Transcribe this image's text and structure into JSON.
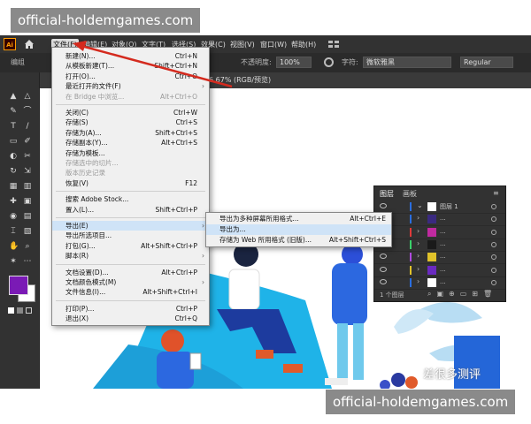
{
  "watermark": {
    "top_text": "official-holdemgames.com",
    "bottom_text": "official-holdemgames.com"
  },
  "app": {
    "logo": "Ai",
    "colors": {
      "menubar": "#323232",
      "menu_bg": "#f0f0f0",
      "highlight": "#cfe3f7",
      "arrow": "#d42a1e",
      "swatch_fill": "#7a1ab5"
    }
  },
  "menubar": {
    "items": [
      "文件(F)",
      "编辑(E)",
      "对象(O)",
      "文字(T)",
      "选择(S)",
      "效果(C)",
      "视图(V)",
      "窗口(W)",
      "帮助(H)"
    ]
  },
  "control_bar": {
    "label_left": "编组",
    "opacity_label": "不透明度:",
    "opacity_value": "100%",
    "char_label": "字符:",
    "font_name": "微软雅黑",
    "font_style": "Regular"
  },
  "document_tab": {
    "zoom_mode": "6.67% (RGB/预览)"
  },
  "file_menu": {
    "items": [
      {
        "label": "新建(N)...",
        "shortcut": "Ctrl+N"
      },
      {
        "label": "从模板新建(T)...",
        "shortcut": "Shift+Ctrl+N"
      },
      {
        "label": "打开(O)...",
        "shortcut": "Ctrl+O"
      },
      {
        "label": "最近打开的文件(F)",
        "shortcut": "",
        "submenu": true
      },
      {
        "label": "在 Bridge 中浏览...",
        "shortcut": "Alt+Ctrl+O",
        "disabled": true
      },
      {
        "label": "关闭(C)",
        "shortcut": "Ctrl+W"
      },
      {
        "label": "存储(S)",
        "shortcut": "Ctrl+S"
      },
      {
        "label": "存储为(A)...",
        "shortcut": "Shift+Ctrl+S"
      },
      {
        "label": "存储副本(Y)...",
        "shortcut": "Alt+Ctrl+S"
      },
      {
        "label": "存储为模板...",
        "shortcut": ""
      },
      {
        "label": "存储选中的切片...",
        "shortcut": "",
        "disabled": true
      },
      {
        "label": "版本历史记录",
        "shortcut": "",
        "disabled": true
      },
      {
        "label": "恢复(V)",
        "shortcut": "F12"
      },
      {
        "label": "搜索 Adobe Stock...",
        "shortcut": ""
      },
      {
        "label": "置入(L)...",
        "shortcut": "Shift+Ctrl+P"
      },
      {
        "label": "导出(E)",
        "shortcut": "",
        "submenu": true,
        "highlighted": true
      },
      {
        "label": "导出所选项目...",
        "shortcut": ""
      },
      {
        "label": "打包(G)...",
        "shortcut": "Alt+Shift+Ctrl+P"
      },
      {
        "label": "脚本(R)",
        "shortcut": "",
        "submenu": true
      },
      {
        "label": "文档设置(D)...",
        "shortcut": "Alt+Ctrl+P"
      },
      {
        "label": "文档颜色模式(M)",
        "shortcut": "",
        "submenu": true
      },
      {
        "label": "文件信息(I)...",
        "shortcut": "Alt+Shift+Ctrl+I"
      },
      {
        "label": "打印(P)...",
        "shortcut": "Ctrl+P"
      },
      {
        "label": "退出(X)",
        "shortcut": "Ctrl+Q"
      }
    ]
  },
  "export_submenu": {
    "items": [
      {
        "label": "导出为多种屏幕所用格式...",
        "shortcut": "Alt+Ctrl+E"
      },
      {
        "label": "导出为...",
        "shortcut": "",
        "highlighted": true
      },
      {
        "label": "存储为 Web 所用格式 (旧版)...",
        "shortcut": "Alt+Shift+Ctrl+S"
      }
    ]
  },
  "layers_panel": {
    "tabs": [
      "图层",
      "画板"
    ],
    "top_layer": "图层 1",
    "row_dots": "...",
    "footer": "1 个图层",
    "row_colors": [
      "#2a6ee0",
      "#2a6ee0",
      "#e03a3a",
      "#3ad06a",
      "#b04ae0",
      "#e0c22a",
      "#2a6ee0"
    ]
  },
  "canvas": {
    "signature": "差很多测评"
  }
}
